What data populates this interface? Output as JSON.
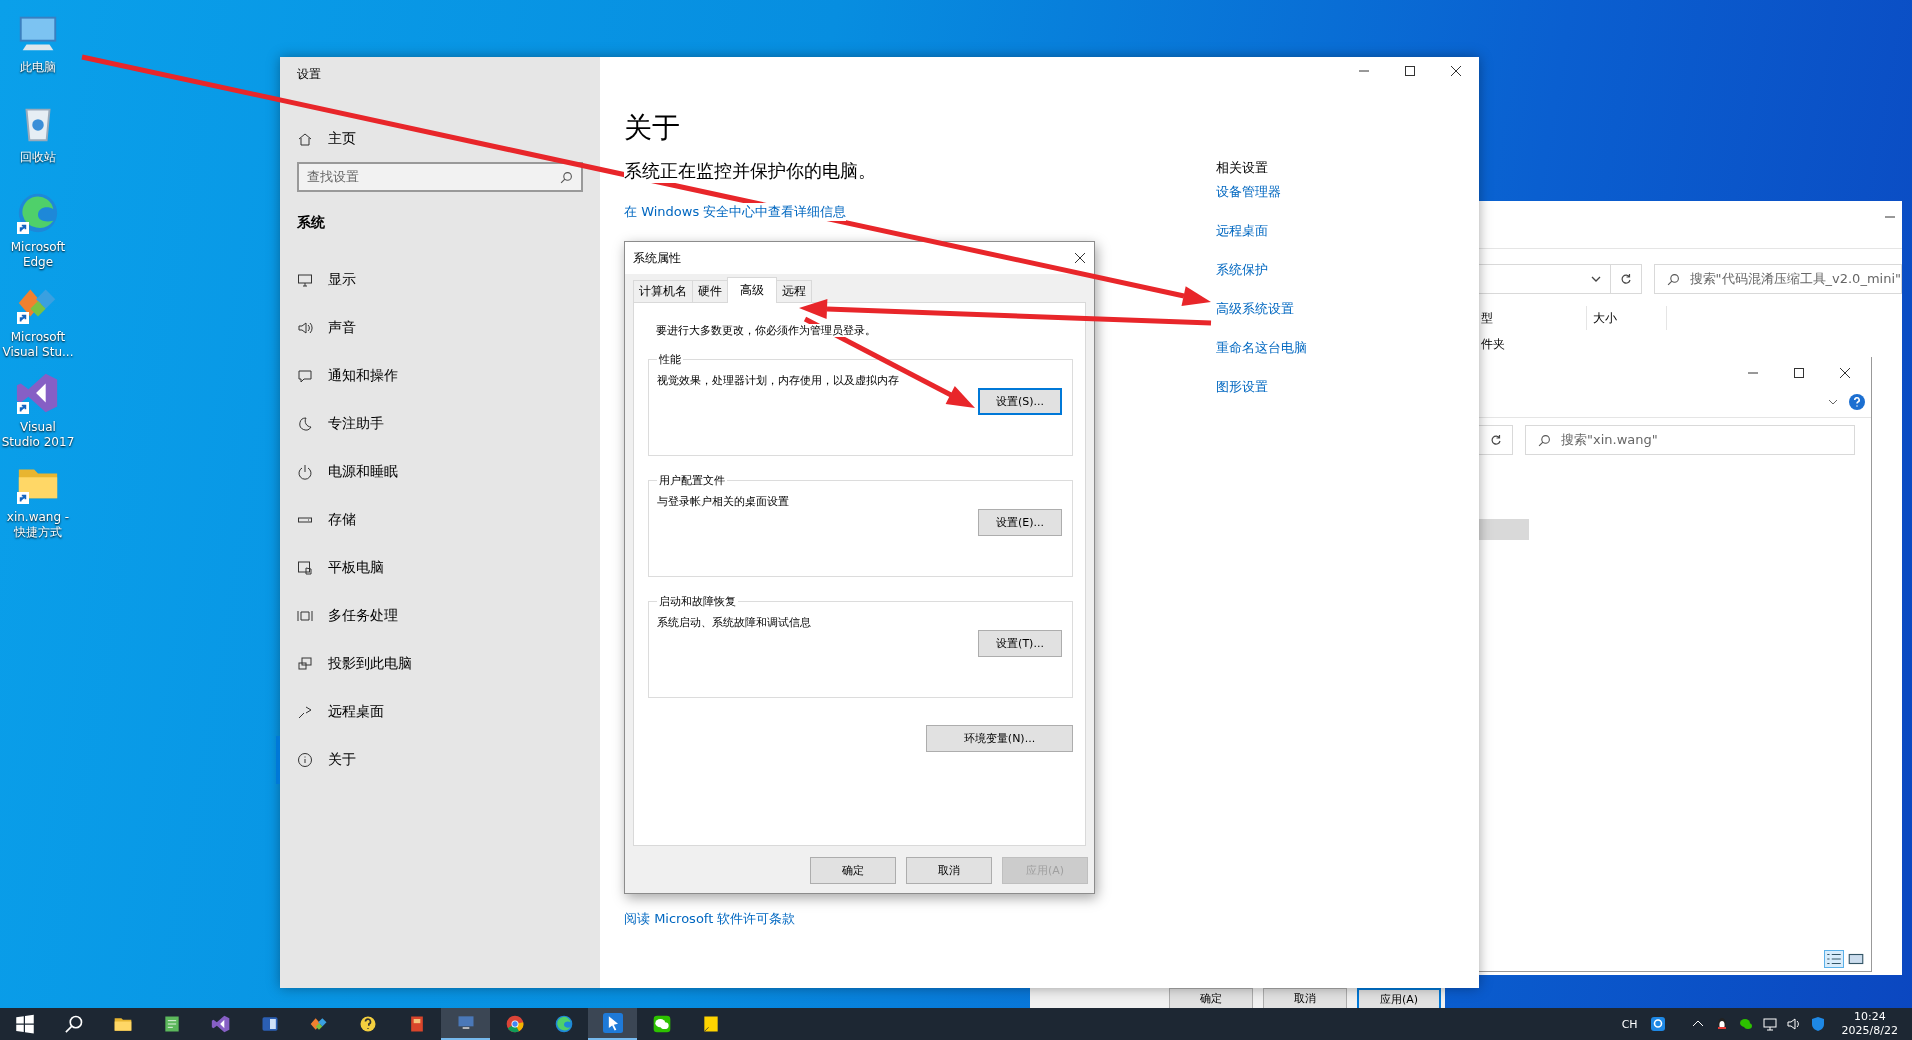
{
  "desktop_icons": [
    {
      "label": "此电脑",
      "kind": "computer",
      "shortcut": false
    },
    {
      "label": "回收站",
      "kind": "recycle",
      "shortcut": false
    },
    {
      "label": "Microsoft Edge",
      "kind": "swirl",
      "shortcut": true
    },
    {
      "label": "Microsoft Visual Stu...",
      "kind": "puzzle",
      "shortcut": true
    },
    {
      "label": "Visual Studio 2017",
      "kind": "ribbon",
      "shortcut": true
    },
    {
      "label": "xin.wang - 快捷方式",
      "kind": "folder",
      "shortcut": true
    }
  ],
  "settings": {
    "title": "设置",
    "home": "主页",
    "search_placeholder": "查找设置",
    "section": "系统",
    "nav": [
      {
        "label": "显示",
        "selected": false
      },
      {
        "label": "声音",
        "selected": false
      },
      {
        "label": "通知和操作",
        "selected": false
      },
      {
        "label": "专注助手",
        "selected": false
      },
      {
        "label": "电源和睡眠",
        "selected": false
      },
      {
        "label": "存储",
        "selected": false
      },
      {
        "label": "平板电脑",
        "selected": false
      },
      {
        "label": "多任务处理",
        "selected": false
      },
      {
        "label": "投影到此电脑",
        "selected": false
      },
      {
        "label": "远程桌面",
        "selected": false
      },
      {
        "label": "关于",
        "selected": true
      }
    ],
    "page_title": "关于",
    "status": "系统正在监控并保护你的电脑。",
    "security_link": "在 Windows 安全中心中查看详细信息",
    "license_link": "阅读 Microsoft 软件许可条款",
    "related_title": "相关设置",
    "related_links": [
      "设备管理器",
      "远程桌面",
      "系统保护",
      "高级系统设置",
      "重命名这台电脑",
      "图形设置"
    ]
  },
  "system_properties": {
    "title": "系统属性",
    "tabs": [
      {
        "label": "计算机名",
        "selected": false
      },
      {
        "label": "硬件",
        "selected": false
      },
      {
        "label": "高级",
        "selected": true
      },
      {
        "label": "远程",
        "selected": false
      }
    ],
    "notice": "要进行大多数更改，你必须作为管理员登录。",
    "groups": [
      {
        "title": "性能",
        "description": "视觉效果，处理器计划，内存使用，以及虚拟内存",
        "button": "设置(S)...",
        "focused": true
      },
      {
        "title": "用户配置文件",
        "description": "与登录帐户相关的桌面设置",
        "button": "设置(E)...",
        "focused": false
      },
      {
        "title": "启动和故障恢复",
        "description": "系统启动、系统故障和调试信息",
        "button": "设置(T)...",
        "focused": false
      }
    ],
    "env_button": "环境变量(N)...",
    "buttons": [
      {
        "label": "确定",
        "disabled": false
      },
      {
        "label": "取消",
        "disabled": false
      },
      {
        "label": "应用(A)",
        "disabled": true
      }
    ]
  },
  "explorer_back": {
    "search_placeholder": "搜索\"代码混淆压缩工具_v2.0_mini\"",
    "columns": [
      "型",
      "大小"
    ],
    "row_text": "件夹"
  },
  "explorer_front": {
    "search_placeholder": "搜索\"xin.wang\""
  },
  "background_dialog_buttons": [
    {
      "label": "确定",
      "focused": false
    },
    {
      "label": "取消",
      "focused": false
    },
    {
      "label": "应用(A)",
      "focused": true
    }
  ],
  "taskbar": {
    "apps": [
      {
        "kind": "folder",
        "active": false
      },
      {
        "kind": "notepad",
        "active": false
      },
      {
        "kind": "ribbon",
        "active": false
      },
      {
        "kind": "document",
        "active": false
      },
      {
        "kind": "puzzle",
        "active": false
      },
      {
        "kind": "help",
        "active": false
      },
      {
        "kind": "book",
        "active": false
      },
      {
        "kind": "monitor",
        "active": true
      },
      {
        "kind": "wheel",
        "active": false
      },
      {
        "kind": "swirl",
        "active": false
      },
      {
        "kind": "cursor",
        "active": true
      },
      {
        "kind": "chat",
        "active": false
      },
      {
        "kind": "note",
        "active": false
      }
    ],
    "ime": "CH",
    "time": "10:24",
    "date": "2025/8/22"
  }
}
